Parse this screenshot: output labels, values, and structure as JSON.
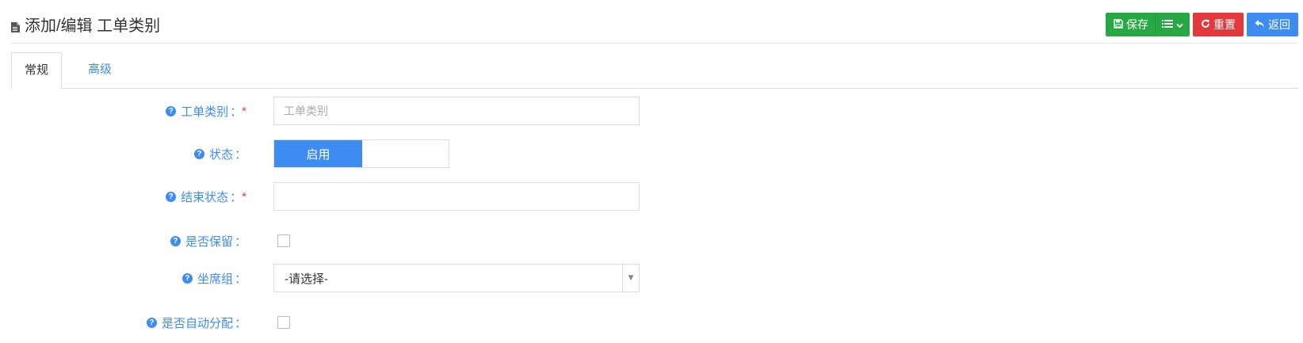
{
  "header": {
    "title": "添加/编辑 工单类别",
    "title_icon": "file-icon",
    "buttons": {
      "save_label": "保存",
      "reset_label": "重置",
      "back_label": "返回"
    },
    "colors": {
      "save": "#28a745",
      "reset": "#e4393c",
      "back": "#3d8cf1"
    }
  },
  "tabs": [
    {
      "label": "常规",
      "active": true
    },
    {
      "label": "高级",
      "active": false
    }
  ],
  "form": {
    "category": {
      "label": "工单类别",
      "required": true,
      "placeholder": "工单类别",
      "value": ""
    },
    "status": {
      "label": "状态",
      "required": false,
      "on_label": "启用",
      "value": "启用"
    },
    "end_status": {
      "label": "结束状态",
      "required": true,
      "value": ""
    },
    "retain": {
      "label": "是否保留",
      "required": false,
      "checked": false
    },
    "seat_group": {
      "label": "坐席组",
      "required": false,
      "selected": "-请选择-"
    },
    "auto_assign": {
      "label": "是否自动分配",
      "required": false,
      "checked": false
    }
  },
  "colon": "："
}
